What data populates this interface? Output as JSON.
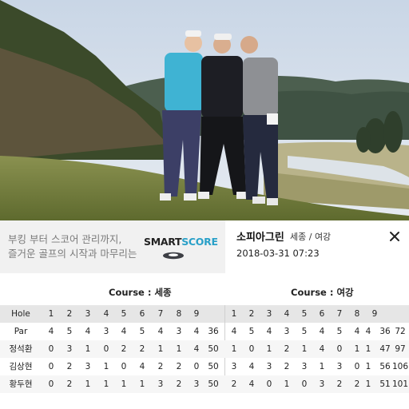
{
  "info": {
    "promo_line1": "부킹 부터 스코어 관리까지,",
    "promo_line2": "즐거운 골프의 시작과 마무리는",
    "brand_part1": "SMART",
    "brand_part2": "SCORE",
    "course_name": "소피아그린",
    "course_sub": "세종 / 여강",
    "datetime": "2018-03-31 07:23",
    "close_icon": "close-icon",
    "brand_color": "#29a0c8"
  },
  "scorecard": {
    "course_front": "Course : 세종",
    "course_back": "Course : 여강",
    "hole_label": "Hole",
    "holes_front": [
      "1",
      "2",
      "3",
      "4",
      "5",
      "6",
      "7",
      "8",
      "9"
    ],
    "holes_back": [
      "1",
      "2",
      "3",
      "4",
      "5",
      "6",
      "7",
      "8",
      "9"
    ],
    "rows": [
      {
        "label": "Par",
        "front": [
          "4",
          "5",
          "4",
          "3",
          "4",
          "5",
          "4",
          "3",
          "4"
        ],
        "front_total": "36",
        "back": [
          "4",
          "5",
          "4",
          "3",
          "5",
          "4",
          "5",
          "4",
          "3"
        ],
        "back_total": "4",
        "sub_total": "36",
        "grand_total": "72"
      },
      {
        "label": "정석환",
        "front": [
          "0",
          "3",
          "1",
          "0",
          "2",
          "2",
          "1",
          "1",
          "4"
        ],
        "front_total": "50",
        "back": [
          "1",
          "0",
          "1",
          "2",
          "1",
          "4",
          "0",
          "1",
          "1"
        ],
        "back_total": "1",
        "sub_total": "47",
        "grand_total": "97"
      },
      {
        "label": "김상현",
        "front": [
          "0",
          "2",
          "3",
          "1",
          "0",
          "4",
          "2",
          "2",
          "0"
        ],
        "front_total": "50",
        "back": [
          "3",
          "4",
          "3",
          "2",
          "3",
          "1",
          "3",
          "0",
          "1"
        ],
        "back_total": "1",
        "sub_total": "56",
        "grand_total": "106"
      },
      {
        "label": "황두현",
        "front": [
          "0",
          "2",
          "1",
          "1",
          "1",
          "1",
          "3",
          "2",
          "3"
        ],
        "front_total": "50",
        "back": [
          "2",
          "4",
          "0",
          "1",
          "0",
          "3",
          "2",
          "2",
          "1"
        ],
        "back_total": "1",
        "sub_total": "51",
        "grand_total": "101"
      }
    ]
  }
}
